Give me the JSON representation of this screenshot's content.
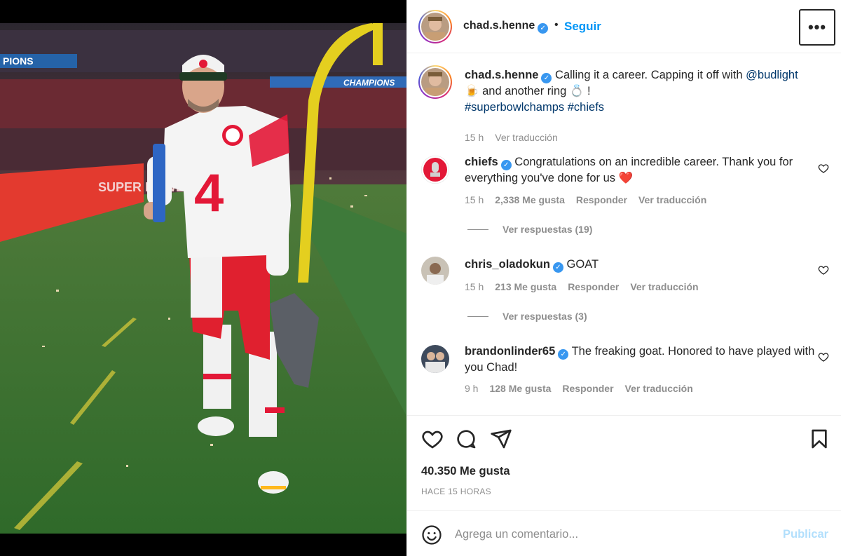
{
  "post": {
    "author": "chad.s.henne",
    "follow_label": "Seguir",
    "separator": "•",
    "more_label": "•••",
    "caption": {
      "text_before": "Calling it a career. Capping it off with ",
      "mention": "@budlight",
      "text_mid": " 🍺 and another ring 💍 !",
      "hashtags": "#superbowlchamps #chiefs",
      "time": "15 h",
      "translate": "Ver traducción"
    },
    "photo": {
      "banner_left": "PIONS",
      "banner_right": "CHAMPIONS",
      "jersey_number": "4",
      "wall_text": "SUPER BOWL"
    }
  },
  "comments": [
    {
      "username": "chiefs",
      "text": "Congratulations on an incredible career. Thank you for everything you've done for us ❤️",
      "time": "15 h",
      "likes": "2,338 Me gusta",
      "reply": "Responder",
      "translate": "Ver traducción",
      "replies": "Ver respuestas (19)"
    },
    {
      "username": "chris_oladokun",
      "text": "GOAT",
      "time": "15 h",
      "likes": "213 Me gusta",
      "reply": "Responder",
      "translate": "Ver traducción",
      "replies": "Ver respuestas (3)"
    },
    {
      "username": "brandonlinder65",
      "text": "The freaking goat. Honored to have played with you Chad!",
      "time": "9 h",
      "likes": "128 Me gusta",
      "reply": "Responder",
      "translate": "Ver traducción"
    }
  ],
  "actions": {
    "likes_count": "40.350 Me gusta",
    "posted_ago": "HACE 15 HORAS"
  },
  "add_comment": {
    "placeholder": "Agrega un comentario...",
    "publish_label": "Publicar"
  },
  "colors": {
    "link_blue": "#0095f6",
    "verified_blue": "#3897f0",
    "chiefs_red": "#e31837",
    "gold": "#ffb81c"
  }
}
